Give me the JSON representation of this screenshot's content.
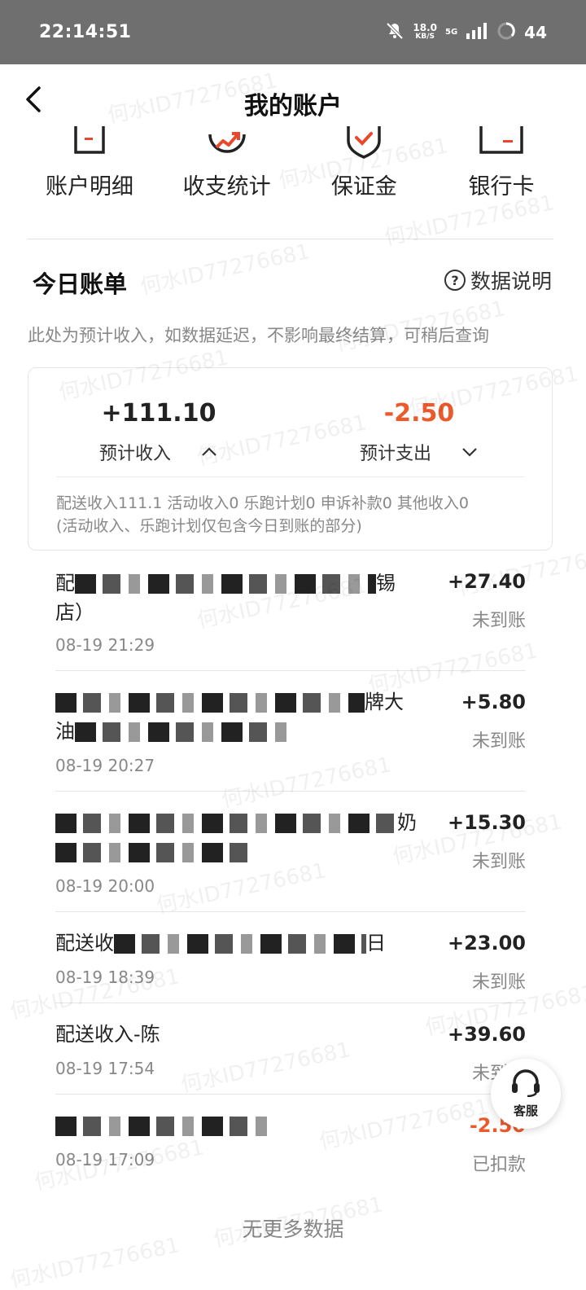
{
  "status_bar": {
    "time": "22:14:51",
    "net_speed_value": "18.0",
    "net_speed_unit": "KB/S",
    "network_type": "5G",
    "battery_level": "44"
  },
  "header": {
    "title": "我的账户"
  },
  "quick_menu": [
    {
      "label": "账户明细",
      "icon": "document-icon"
    },
    {
      "label": "收支统计",
      "icon": "trend-chart-icon"
    },
    {
      "label": "保证金",
      "icon": "shield-check-icon"
    },
    {
      "label": "银行卡",
      "icon": "bank-card-icon"
    }
  ],
  "today_bill": {
    "title": "今日账单",
    "help_label": "数据说明",
    "note": "此处为预计收入，如数据延迟，不影响最终结算，可稍后查询",
    "income_amount": "+111.10",
    "income_label": "预计收入",
    "expense_amount": "-2.50",
    "expense_label": "预计支出",
    "breakdown_line1": "配送收入111.1 活动收入0 乐跑计划0 申诉补款0 其他收入0",
    "breakdown_line2": "(活动收入、乐跑计划仅包含今日到账的部分)"
  },
  "transactions": [
    {
      "title_prefix": "配",
      "title_suffix": "锡",
      "title_line2": "店）",
      "time": "08-19 21:29",
      "amount": "+27.40",
      "status": "未到账"
    },
    {
      "title_prefix": "",
      "title_suffix": "牌大",
      "title_line2": "油",
      "time": "08-19 20:27",
      "amount": "+5.80",
      "status": "未到账"
    },
    {
      "title_prefix": "",
      "title_suffix": "奶",
      "title_line2": "",
      "time": "08-19 20:00",
      "amount": "+15.30",
      "status": "未到账"
    },
    {
      "title_prefix": "配送收",
      "title_suffix": "日",
      "title_line2": "",
      "time": "08-19 18:39",
      "amount": "+23.00",
      "status": "未到账"
    },
    {
      "title_prefix": "配送收入-陈",
      "title_suffix": "",
      "title_line2": "",
      "time": "08-19 17:54",
      "amount": "+39.60",
      "status": "未到账"
    },
    {
      "title_prefix": "",
      "title_suffix": "",
      "title_line2": "",
      "time": "08-19 17:09",
      "amount": "-2.50",
      "status": "已扣款"
    }
  ],
  "footer": {
    "no_more": "无更多数据"
  },
  "fab": {
    "label": "客服"
  },
  "watermark": "何水ID77276681",
  "colors": {
    "accent_negative": "#ec5a2c",
    "status_bar": "#6f6f6f",
    "icon_red": "#e8492c"
  }
}
